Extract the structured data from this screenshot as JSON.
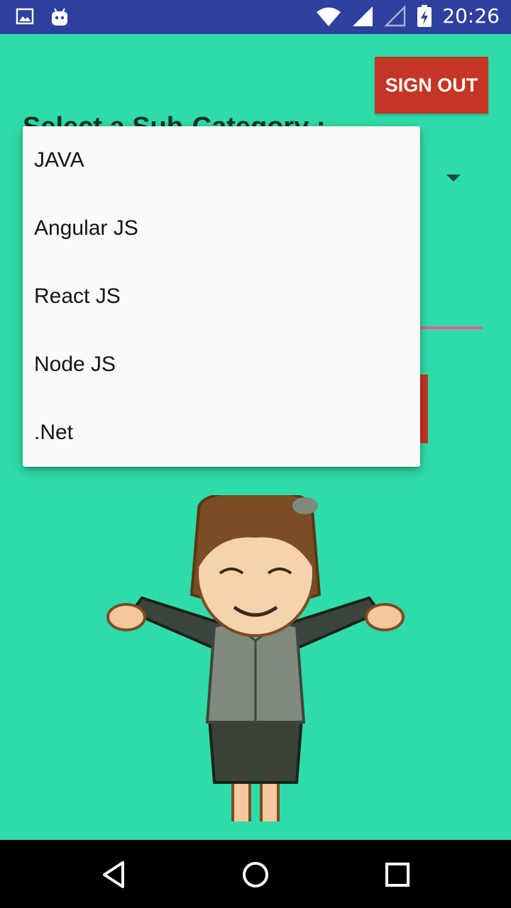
{
  "status_bar": {
    "time": "20:26",
    "icons": [
      "image-notification-icon",
      "android-robot-icon",
      "wifi-icon",
      "signal-icon",
      "signal-empty-icon",
      "battery-charging-icon"
    ]
  },
  "header": {
    "sign_out_label": "SIGN OUT",
    "title": "Select a Sub-Category :"
  },
  "dropdown": {
    "items": [
      "JAVA",
      "Angular JS",
      "React JS",
      "Node JS",
      ".Net"
    ]
  },
  "nav_bar": {
    "icons": [
      "back-icon",
      "home-icon",
      "recents-icon"
    ]
  },
  "colors": {
    "background": "#2fdca9",
    "status_bar": "#2f3f9e",
    "sign_out": "#c43525",
    "accent_line": "#e0609a",
    "dropdown_bg": "#fafafa"
  }
}
